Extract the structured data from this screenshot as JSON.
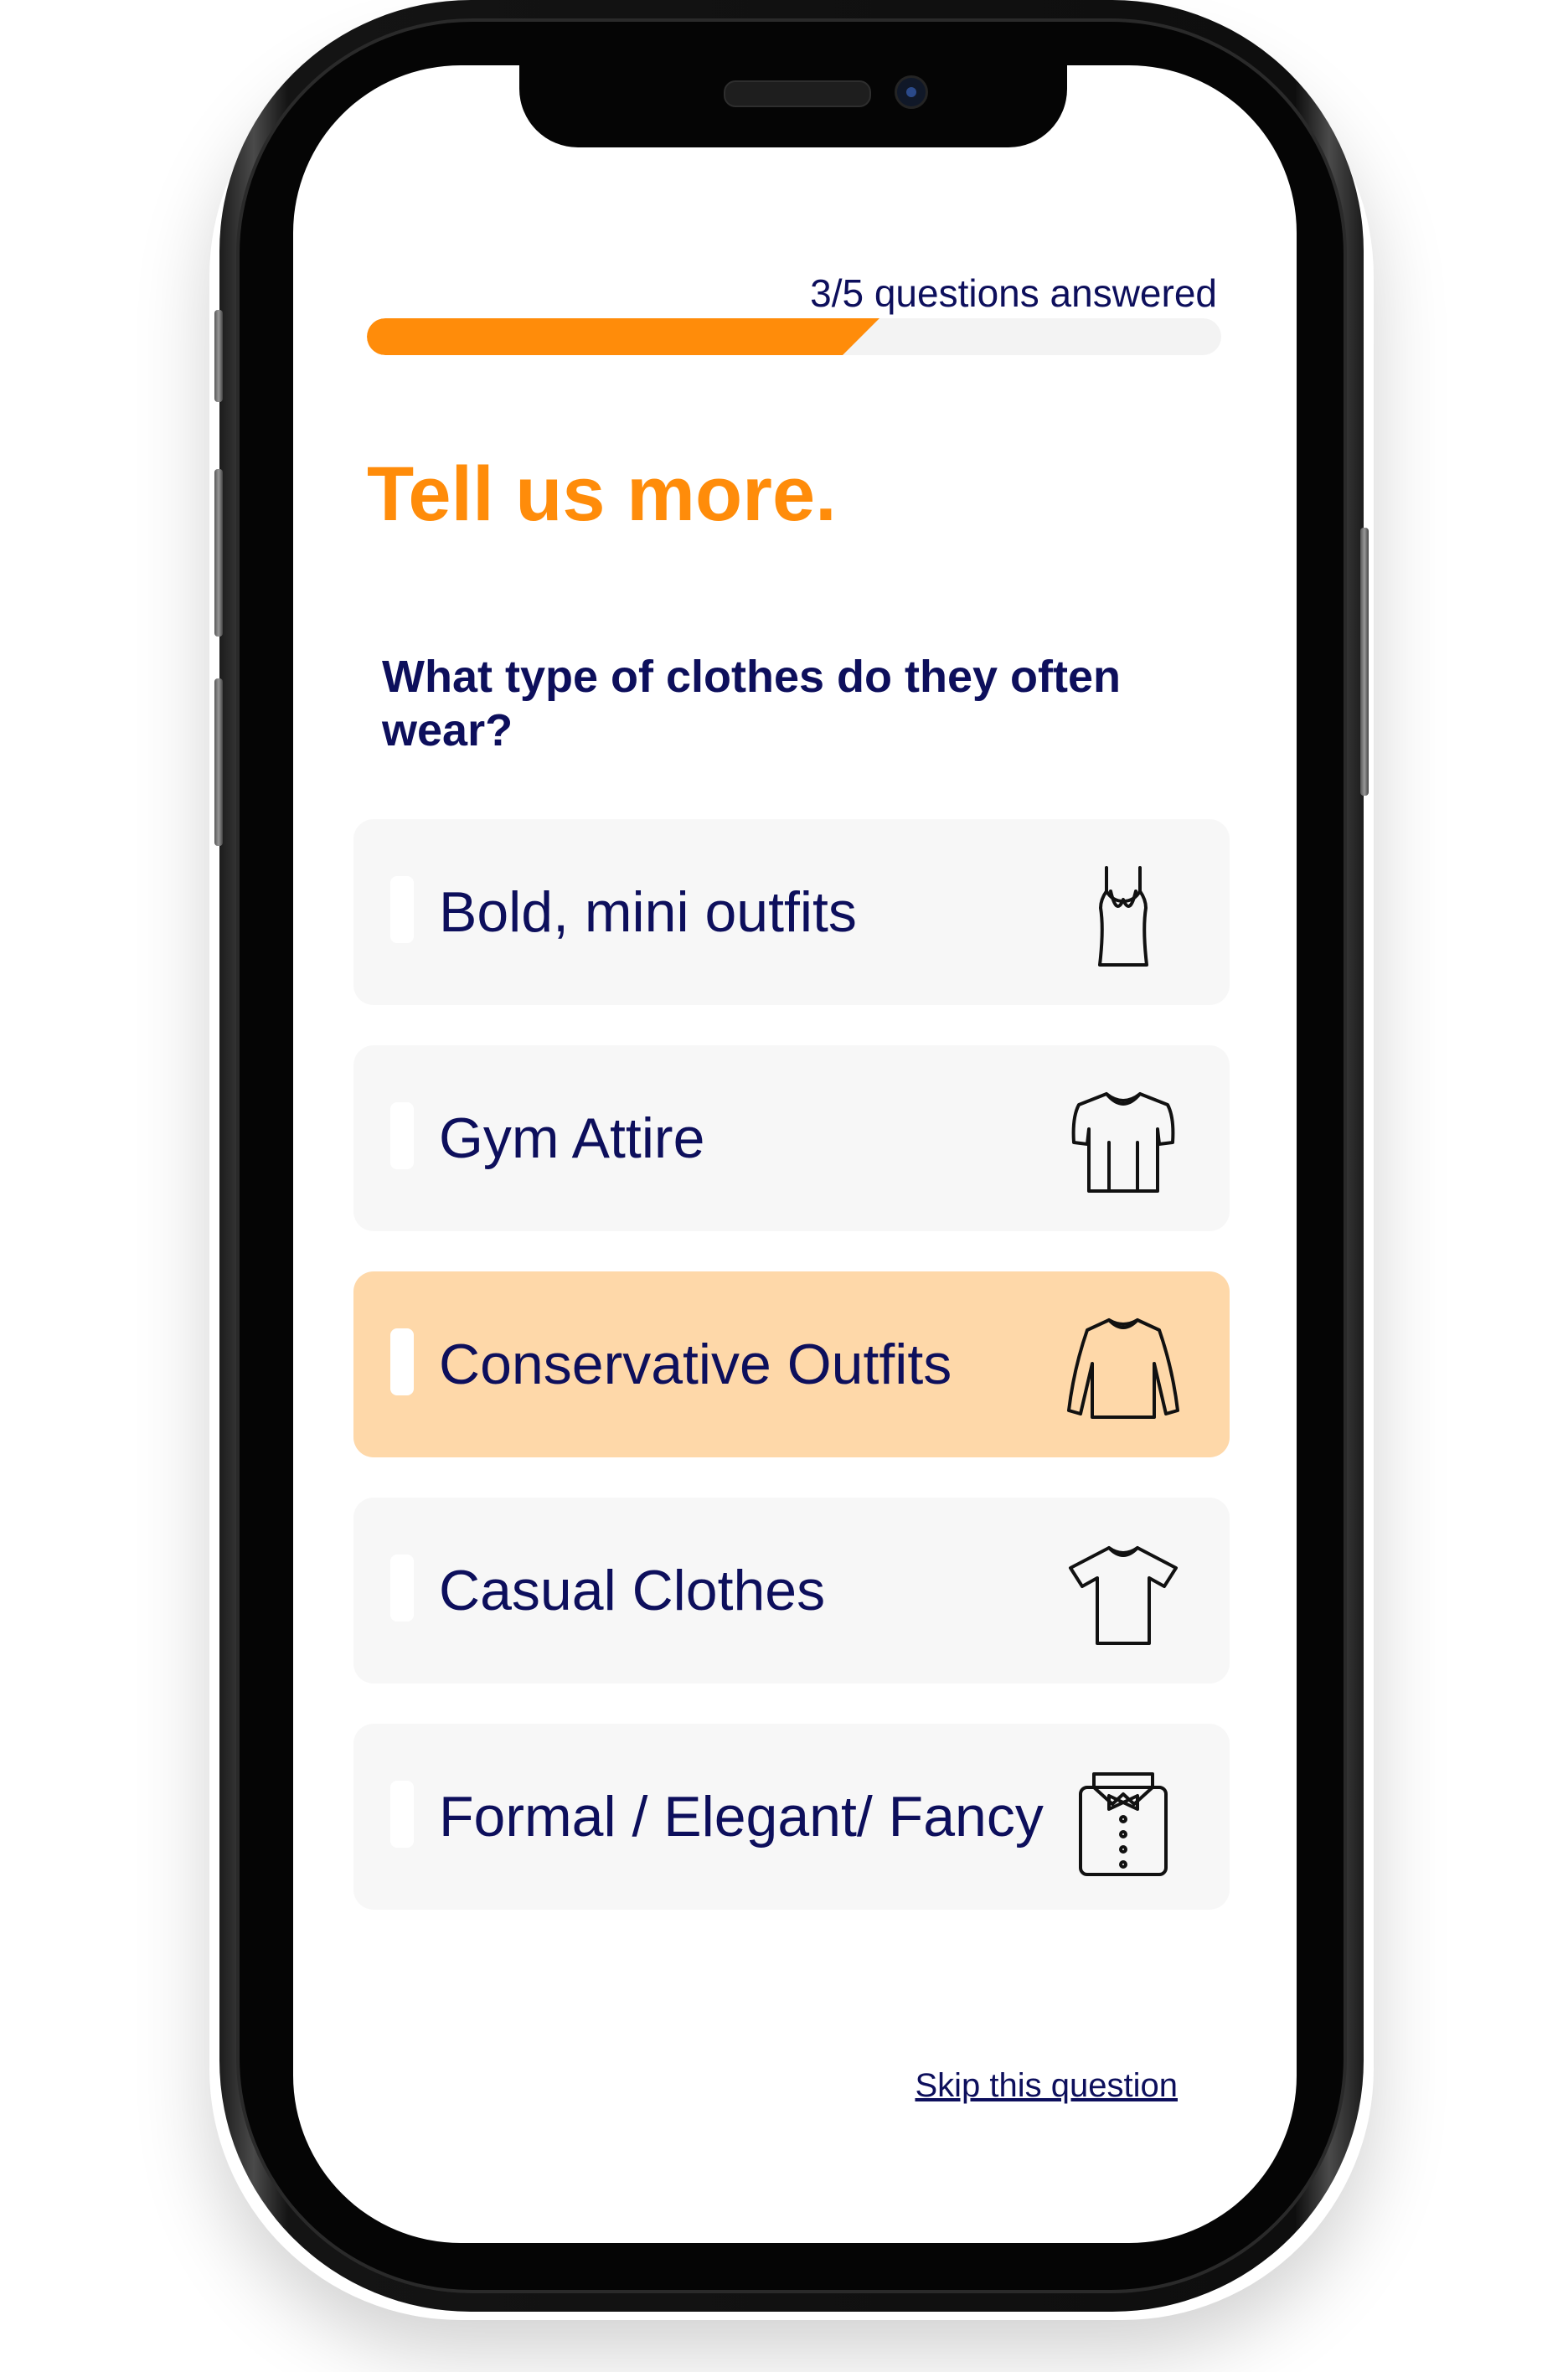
{
  "progress": {
    "label": "3/5 questions answered",
    "answered": 3,
    "total": 5,
    "color": "#ff8c0a"
  },
  "page": {
    "title": "Tell us more.",
    "question": "What type of clothes do they often wear?"
  },
  "options": [
    {
      "label": "Bold, mini outfits",
      "icon": "tank-top-icon",
      "selected": false
    },
    {
      "label": "Gym Attire",
      "icon": "athletic-shirt-icon",
      "selected": false
    },
    {
      "label": "Conservative Outfits",
      "icon": "long-sleeve-shirt-icon",
      "selected": true
    },
    {
      "label": "Casual Clothes",
      "icon": "t-shirt-icon",
      "selected": false
    },
    {
      "label": "Formal / Elegant/ Fancy",
      "icon": "tuxedo-shirt-icon",
      "selected": false
    }
  ],
  "footer": {
    "skip_label": "Skip this question"
  },
  "colors": {
    "accent": "#ff8c0a",
    "text": "#0d0f5c",
    "option_bg": "#f7f7f7",
    "option_selected_bg": "#fed8a9"
  }
}
